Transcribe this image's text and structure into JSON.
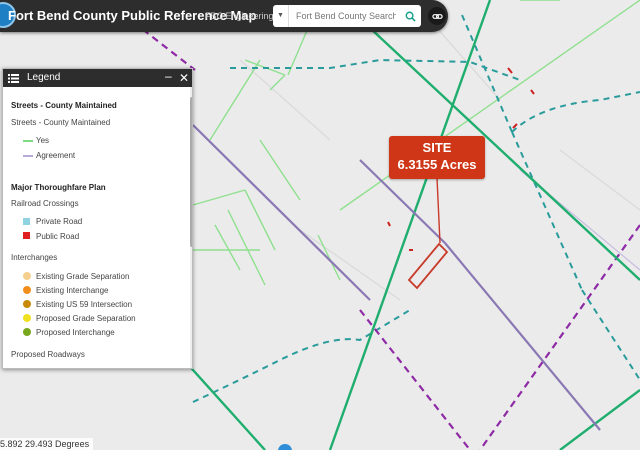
{
  "header": {
    "title": "Fort Bend County Public Reference Map",
    "subtitle": "FBC Engineering GIS",
    "search_placeholder": "Fort Bend County Search"
  },
  "legend": {
    "title": "Legend",
    "sections": {
      "streets_heading": "Streets - County Maintained",
      "streets_sub": "Streets - County Maintained",
      "yes": "Yes",
      "agreement": "Agreement",
      "thoroughfare_heading": "Major Thoroughfare Plan",
      "railroad": "Railroad Crossings",
      "private_road": "Private Road",
      "public_road": "Public Road",
      "interchanges": "Interchanges",
      "existing_grade": "Existing Grade Separation",
      "existing_interchange": "Existing Interchange",
      "existing_us59": "Existing US 59 Intersection",
      "proposed_grade": "Proposed Grade Separation",
      "proposed_interchange": "Proposed Interchange",
      "proposed_roadways": "Proposed Roadways"
    },
    "colors": {
      "yes": "#7ddc7d",
      "agreement": "#b9a9d9",
      "private_road": "#8fd3e0",
      "public_road": "#e02020",
      "existing_grade": "#f5cf8e",
      "existing_interchange": "#f28f1c",
      "existing_us59": "#c78a0a",
      "proposed_grade": "#f0e020",
      "proposed_interchange": "#78a81e"
    }
  },
  "site": {
    "line1": "SITE",
    "line2": "6.3155 Acres"
  },
  "coords": "5.892 29.493 Degrees",
  "map_colors": {
    "background": "#ebebeb",
    "thoroughfare": "#1fae6e",
    "agreement_road": "#8a78b4",
    "rail": "#8e2aa5",
    "teal_dashed": "#2a9b9b",
    "county_road": "#8fe08f",
    "site_outline": "#c83a2a"
  }
}
